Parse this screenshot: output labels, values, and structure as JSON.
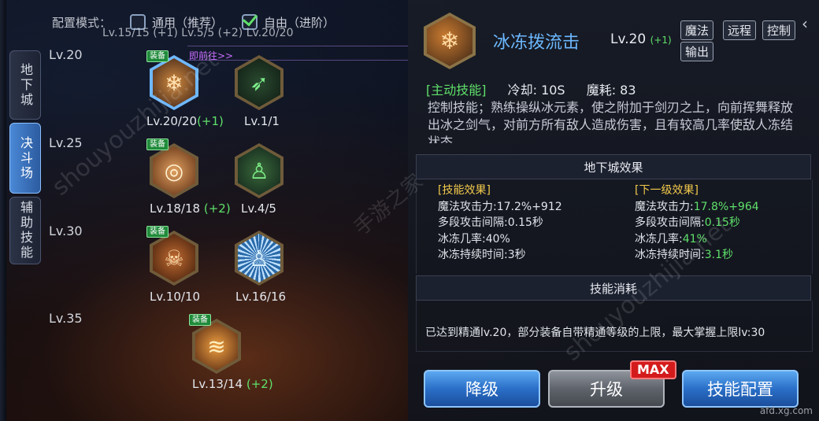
{
  "config": {
    "label": "配置模式：",
    "option_general": "通用（推荐）",
    "option_free": "自由（进阶）",
    "general_checked": false,
    "free_checked": true
  },
  "tabs": [
    {
      "label": "地下城",
      "active": false
    },
    {
      "label": "决斗场",
      "active": true
    },
    {
      "label": "辅助技能",
      "active": false
    }
  ],
  "level_labels": [
    "Lv.20",
    "Lv.25",
    "Lv.30",
    "Lv.35"
  ],
  "top_cut_text": "Lv.15/15 (+1)  Lv.5/5  (+2) Lv.20/20",
  "goto_text": "即前往>>",
  "skills": [
    {
      "level": "Lv.20/20",
      "bonus": "(+1)",
      "badge": "装备",
      "icon": "ice-burst-icon",
      "color": "#c07030",
      "selected": true
    },
    {
      "level": "Lv.1/1",
      "bonus": "",
      "badge": "",
      "icon": "green-slash-icon",
      "color": "#2fa050",
      "selected": false
    },
    {
      "level": "Lv.18/18",
      "bonus": "(+2)",
      "badge": "装备",
      "icon": "fire-swirl-icon",
      "color": "#c86a20",
      "selected": false
    },
    {
      "level": "Lv.4/5",
      "bonus": "",
      "badge": "",
      "icon": "green-body-icon",
      "color": "#3fb04a",
      "selected": false
    },
    {
      "level": "Lv.10/10",
      "bonus": "",
      "badge": "装备",
      "icon": "skull-icon",
      "color": "#b05a20",
      "selected": false
    },
    {
      "level": "Lv.16/16",
      "bonus": "",
      "badge": "",
      "icon": "blue-aura-icon",
      "color": "#3a88c8",
      "selected": false
    },
    {
      "level": "Lv.13/14",
      "bonus": "(+2)",
      "badge": "装备",
      "icon": "fire-wave-icon",
      "color": "#c86a20",
      "selected": false
    }
  ],
  "detail": {
    "name": "冰冻拨流击",
    "level": "Lv.20",
    "level_bonus": "(+1)",
    "tags": [
      "魔法",
      "远程",
      "控制",
      "输出"
    ],
    "type_label": "[主动技能]",
    "cooldown": "冷却: 10S",
    "mana": "魔耗: 83",
    "description": "控制技能；熟练操纵冰元素，使之附加于剑刃之上，向前挥舞释放出冰之剑气，对前方所有敌人造成伤害，且有较高几率使敌人冻结状态",
    "section_effect": "地下城效果",
    "current_header": "[技能效果]",
    "next_header": "[下一级效果]",
    "current_lines": [
      "魔法攻击力:17.2%+912",
      "多段攻击间隔:0.15秒",
      "冰冻几率:40%",
      "冰冻持续时间:3秒"
    ],
    "next_labels": [
      "魔法攻击力:",
      "多段攻击间隔:",
      "冰冻几率:",
      "冰冻持续时间:"
    ],
    "next_values": [
      "17.8%+964",
      "0.15秒",
      "41%",
      "3.1秒"
    ],
    "section_cost": "技能消耗",
    "cost_text": "已达到精通lv.20，部分装备自带精通等级的上限，最大掌握上限lv:30"
  },
  "buttons": {
    "downgrade": "降级",
    "upgrade": "升级",
    "max_badge": "MAX",
    "config": "技能配置"
  },
  "watermarks": [
    "shouyouzhijia.net",
    "手游之家",
    "shouyouzhijia.net"
  ],
  "site_mark": "afd.xg.com"
}
